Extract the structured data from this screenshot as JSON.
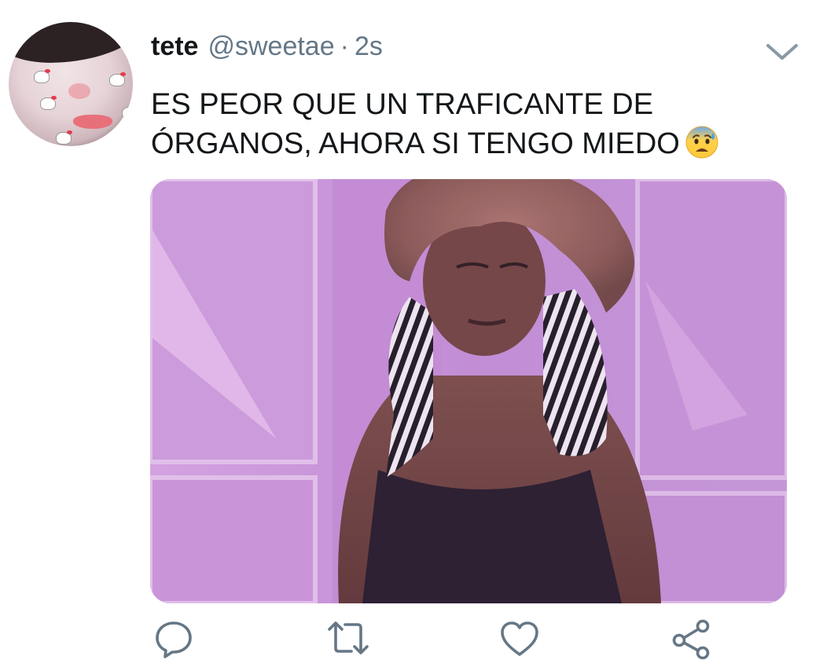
{
  "tweet": {
    "display_name": "tete",
    "handle": "@sweetae",
    "separator": "·",
    "timestamp": "2s",
    "text_lines": [
      "ES PEOR QUE UN TRAFICANTE DE",
      "ÓRGANOS, AHORA SI TENGO MIEDO"
    ],
    "emoji": "anxious-face-with-sweat-icon"
  },
  "icons": {
    "menu": "chevron-down-icon",
    "reply": "reply-icon",
    "retweet": "retweet-icon",
    "like": "heart-icon",
    "share": "share-icon"
  },
  "colors": {
    "text": "#14171a",
    "muted": "#657786",
    "background": "#ffffff",
    "media_tint": "#c79ad6"
  }
}
